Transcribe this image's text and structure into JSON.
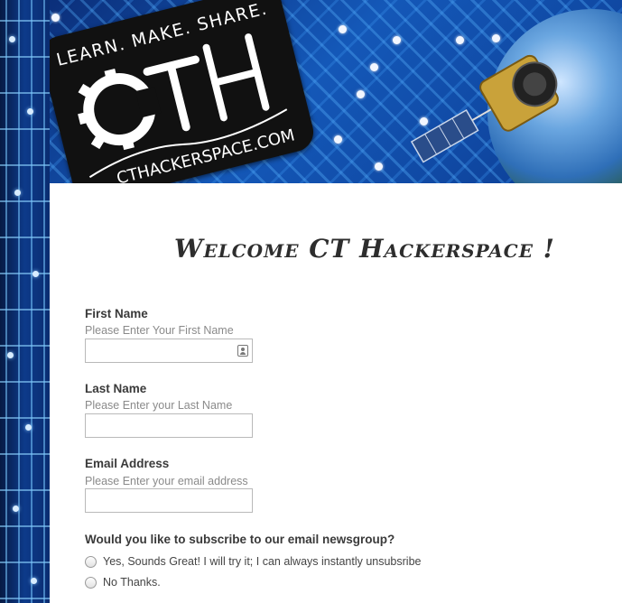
{
  "header": {
    "logo_top_text": "LEARN. MAKE. SHARE.",
    "logo_letters": "CT",
    "logo_url": "CTHACKERSPACE.COM"
  },
  "form": {
    "title": "Welcome CT Hackerspace !",
    "first_name": {
      "label": "First Name",
      "hint": "Please Enter Your First Name",
      "value": ""
    },
    "last_name": {
      "label": "Last Name",
      "hint": "Please Enter your Last Name",
      "value": ""
    },
    "email": {
      "label": "Email Address",
      "hint": "Please Enter your email address",
      "value": ""
    },
    "subscribe": {
      "question": "Would you like to subscribe to our email newsgroup?",
      "options": [
        "Yes, Sounds Great! I will try it; I can always instantly unsubsribe",
        "No Thanks."
      ],
      "selected": null
    }
  }
}
